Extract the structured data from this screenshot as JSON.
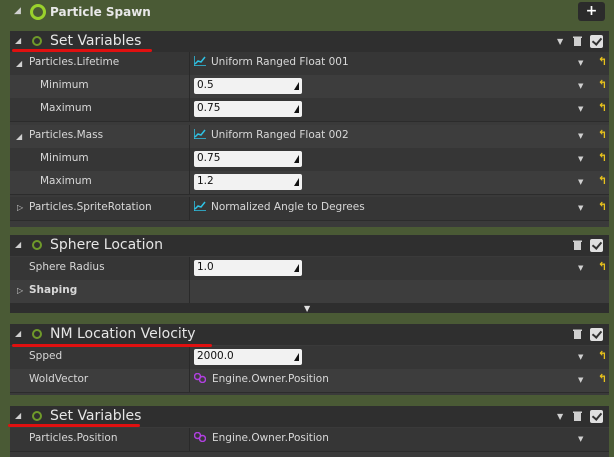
{
  "stage": {
    "title": "Particle Spawn",
    "add_label": "+"
  },
  "modules": [
    {
      "title": "Set Variables",
      "rows": [
        {
          "label": "Particles.Lifetime",
          "kind": "function",
          "value": "Uniform Ranged Float 001"
        },
        {
          "label": "Minimum",
          "kind": "field",
          "value": "0.5"
        },
        {
          "label": "Maximum",
          "kind": "field",
          "value": "0.75"
        },
        {
          "label": "Particles.Mass",
          "kind": "function",
          "value": "Uniform Ranged Float 002"
        },
        {
          "label": "Minimum",
          "kind": "field",
          "value": "0.75"
        },
        {
          "label": "Maximum",
          "kind": "field",
          "value": "1.2"
        },
        {
          "label": "Particles.SpriteRotation",
          "kind": "function",
          "value": "Normalized Angle to Degrees"
        }
      ]
    },
    {
      "title": "Sphere Location",
      "rows": [
        {
          "label": "Sphere Radius",
          "kind": "field",
          "value": "1.0"
        },
        {
          "label": "Shaping",
          "kind": "category",
          "value": ""
        }
      ]
    },
    {
      "title": "NM Location Velocity",
      "rows": [
        {
          "label": "Spped",
          "kind": "field",
          "value": "2000.0"
        },
        {
          "label": "WoldVector",
          "kind": "link",
          "value": "Engine.Owner.Position"
        }
      ]
    },
    {
      "title": "Set Variables",
      "rows": [
        {
          "label": "Particles.Position",
          "kind": "link",
          "value": "Engine.Owner.Position"
        }
      ]
    }
  ],
  "colors": {
    "stage_bg": "#4a5a35",
    "accent_green": "#9ad22c",
    "reset_yellow": "#e8c21c",
    "annotation_red": "#e01010",
    "curve_icon": "#2ec3e6",
    "link_icon": "#b040e0"
  },
  "icons": {
    "collapse": "collapse-arrow-icon",
    "expand": "expand-arrow-icon",
    "trash": "trash-icon",
    "check": "checkbox-icon",
    "reset": "reset-arrow-icon",
    "curve": "curve-icon",
    "link": "link-icon"
  }
}
